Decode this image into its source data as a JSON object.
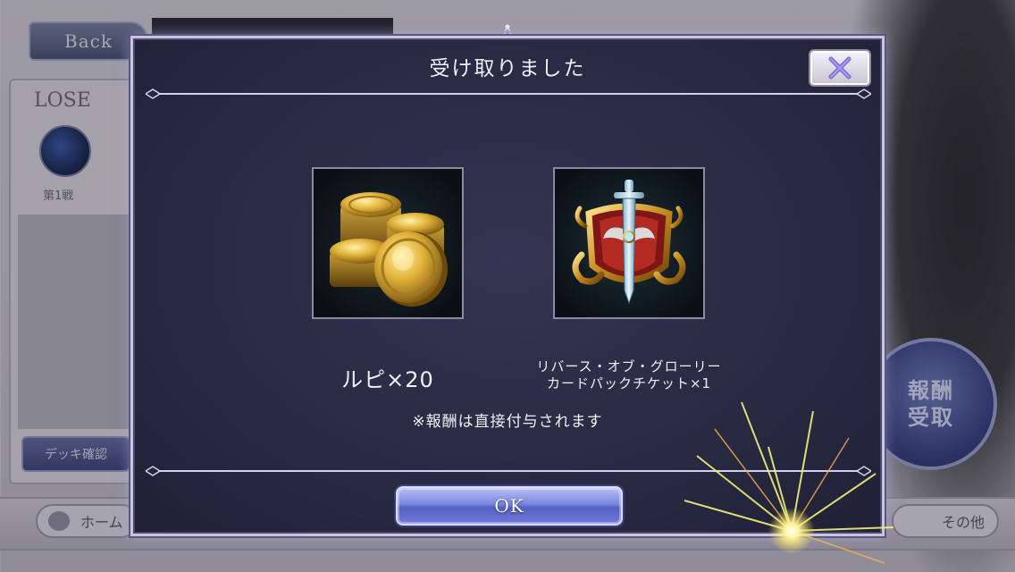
{
  "background": {
    "back_label": "Back",
    "result_label": "LOSE",
    "round_label": "第1戦",
    "deck_label": "デッキ確認",
    "home_label": "ホーム",
    "other_label": "その他",
    "reward_button_label": "報酬\n受取"
  },
  "dialog": {
    "title": "受け取りました",
    "items": [
      {
        "name": "ルピ×20",
        "icon": "gold-coins-icon"
      },
      {
        "name_line1": "リバース・オブ・グローリー",
        "name_line2": "カードパックチケット×1",
        "icon": "card-pack-ticket-icon"
      }
    ],
    "note": "※報酬は直接付与されます",
    "ok_label": "OK",
    "close_icon": "close-x-icon"
  },
  "colors": {
    "dialog_bg": "#272941",
    "dialog_border": "#c9c3e8",
    "ok_button": "#6e79d6",
    "text": "#f2f0f6"
  }
}
